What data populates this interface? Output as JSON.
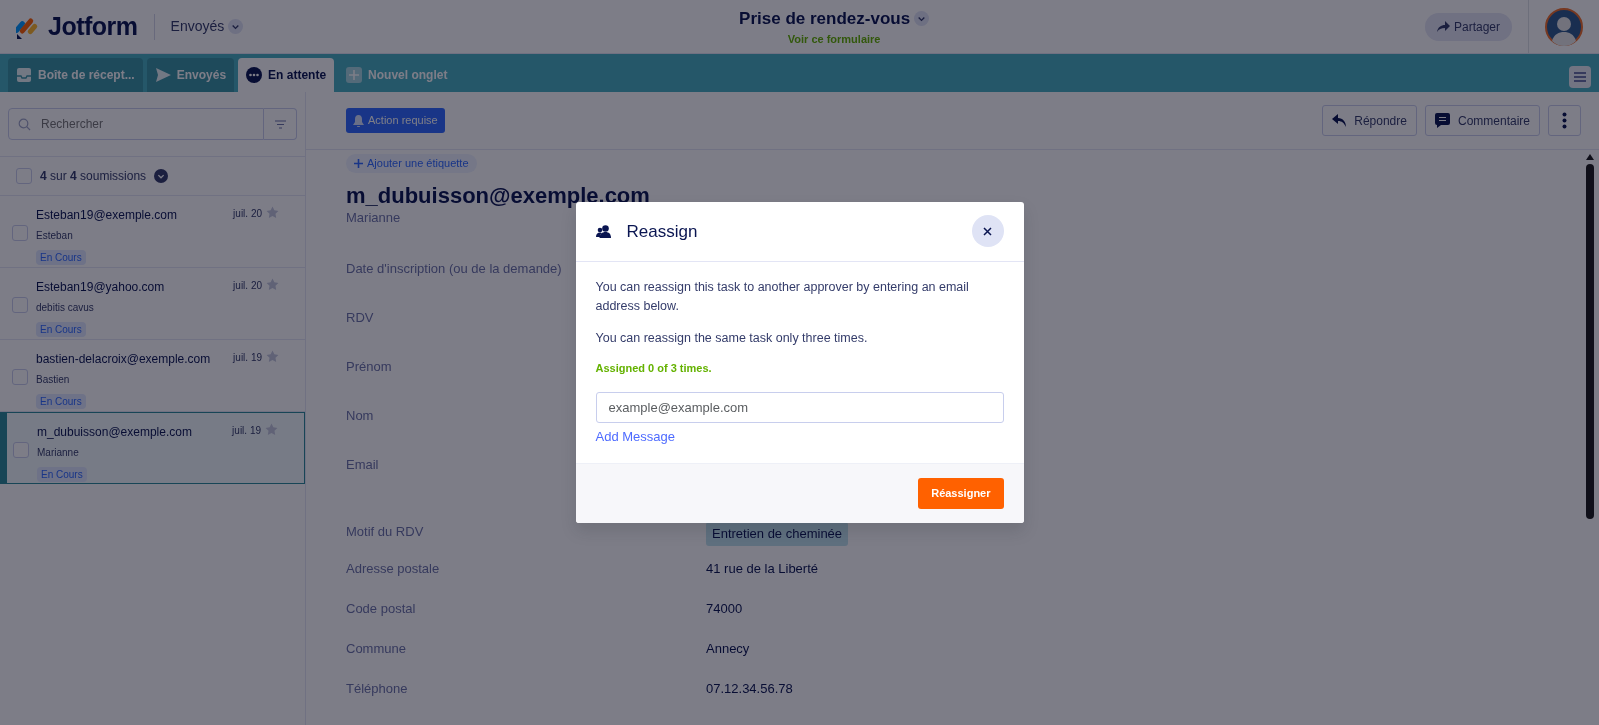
{
  "header": {
    "logo": "Jotform",
    "folder": "Envoyés",
    "form_title": "Prise de rendez-vous",
    "form_link": "Voir ce formulaire",
    "share": "Partager"
  },
  "tabs": [
    {
      "label": "Boîte de récept...",
      "kind": "inbox",
      "selected": false
    },
    {
      "label": "Envoyés",
      "kind": "send",
      "selected": false
    },
    {
      "label": "En attente",
      "kind": "dots",
      "selected": true
    },
    {
      "label": "Nouvel onglet",
      "kind": "plus",
      "selected": false
    }
  ],
  "sidebar": {
    "search": {
      "placeholder": "Rechercher"
    },
    "count": "**4** sur **4** soumissions",
    "all_checked": false,
    "items": [
      {
        "email": "Esteban19@exemple.com",
        "name": "Esteban",
        "date": "juil. 20",
        "status": "En Cours",
        "checked": false,
        "starred": false,
        "selected": false
      },
      {
        "email": "Esteban19@yahoo.com",
        "name": "debitis cavus",
        "date": "juil. 20",
        "status": "En Cours",
        "checked": false,
        "starred": false,
        "selected": false
      },
      {
        "email": "bastien-delacroix@exemple.com",
        "name": "Bastien",
        "date": "juil. 19",
        "status": "En Cours",
        "checked": false,
        "starred": false,
        "selected": false
      },
      {
        "email": "m_dubuisson@exemple.com",
        "name": "Marianne",
        "date": "juil. 19",
        "status": "En Cours",
        "checked": false,
        "starred": false,
        "selected": true
      }
    ]
  },
  "toolbar": {
    "action": "Action requise",
    "reply": "Répondre",
    "comment": "Commentaire"
  },
  "submission": {
    "add_tag": "Ajouter une étiquette",
    "title": "m_dubuisson@exemple.com",
    "subtitle": "Marianne",
    "fields": [
      {
        "label": "Date d'inscription (ou de la demande)"
      },
      {
        "label": "RDV"
      },
      {
        "label": "Prénom"
      },
      {
        "label": "Nom"
      },
      {
        "label": "Email"
      },
      {
        "label": "Motif du RDV",
        "value": "Entretien de cheminée",
        "kind": "tag"
      },
      {
        "label": "Adresse postale",
        "value": "41 rue de la Liberté",
        "kind": "text"
      },
      {
        "label": "Code postal",
        "value": "74000",
        "kind": "text"
      },
      {
        "label": "Commune",
        "value": "Annecy",
        "kind": "text"
      },
      {
        "label": "Téléphone",
        "value": "07.12.34.56.78",
        "kind": "text"
      }
    ]
  },
  "modal": {
    "title": "Reassign",
    "paragraphs": [
      "You can reassign this task to another approver by entering an email address below.",
      "You can reassign the same task only three times."
    ],
    "counter": "Assigned 0 of 3 times.",
    "email": {
      "placeholder": "example@example.com"
    },
    "add_message": "Add Message",
    "submit": "Réassigner"
  }
}
